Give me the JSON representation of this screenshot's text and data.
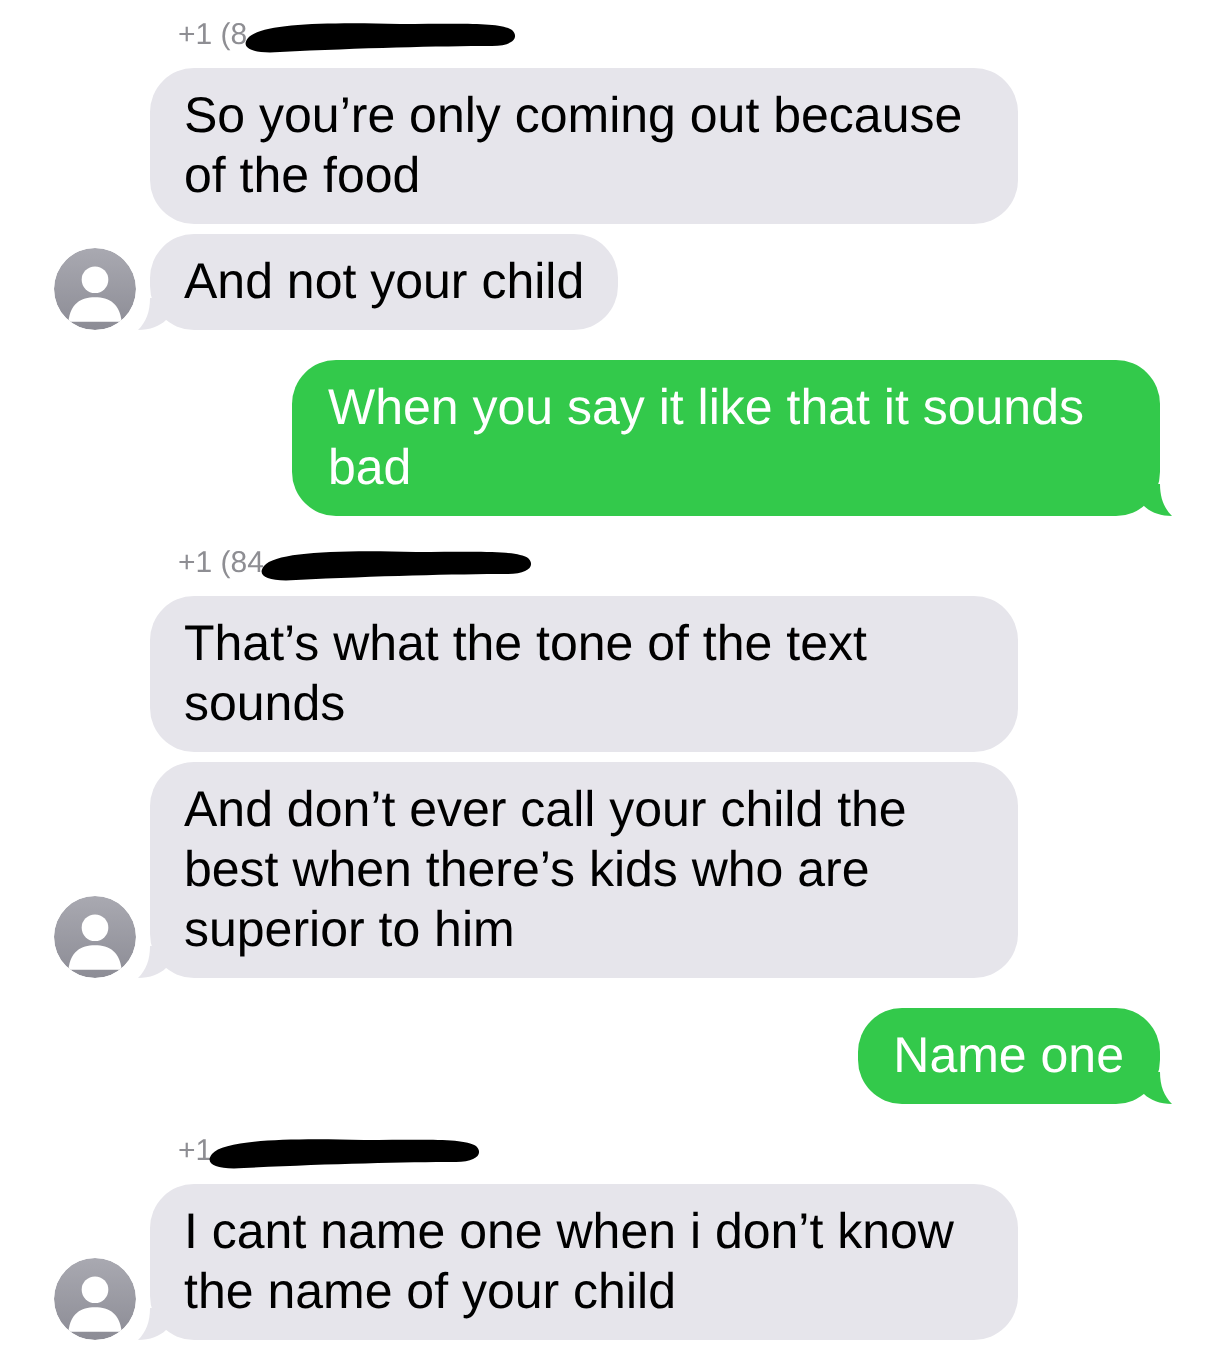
{
  "thread": [
    {
      "kind": "sender",
      "text": "+1 (8",
      "redacted": true
    },
    {
      "kind": "received",
      "text": "So you’re only coming out because of the food",
      "avatar": false
    },
    {
      "kind": "received",
      "text": "And not your child",
      "avatar": true
    },
    {
      "kind": "sent",
      "text": "When you say it like that it sounds bad"
    },
    {
      "kind": "sender",
      "text": "+1 (84",
      "redacted": true
    },
    {
      "kind": "received",
      "text": "That’s what the tone of the text sounds",
      "avatar": false
    },
    {
      "kind": "received",
      "text": "And don’t ever call your child the best when there’s kids who are superior to him",
      "avatar": true
    },
    {
      "kind": "sent",
      "text": "Name one"
    },
    {
      "kind": "sender",
      "text": "+1",
      "redacted": true
    },
    {
      "kind": "received",
      "text": "I cant name one when i don’t know the name of your child",
      "avatar": true
    }
  ]
}
